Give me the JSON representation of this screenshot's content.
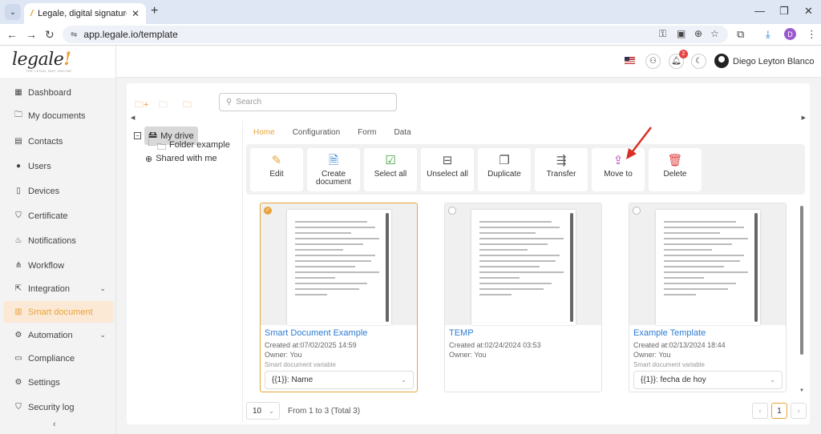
{
  "browser": {
    "tab_title": "Legale, digital signature",
    "url_site_icon": "⇋",
    "url": "app.legale.io/template",
    "profile_initial": "D"
  },
  "header": {
    "logo": "legale",
    "logo_tagline": "THE LEGAL WAY ONLINE",
    "notifications_count": "2",
    "username": "Diego Leyton Blanco"
  },
  "sidebar": {
    "items": [
      {
        "label": "Dashboard",
        "icon": "grid-icon"
      },
      {
        "label": "My documents",
        "icon": "folder-icon"
      },
      {
        "label": "Contacts",
        "icon": "contacts-icon"
      },
      {
        "label": "Users",
        "icon": "user-icon"
      },
      {
        "label": "Devices",
        "icon": "device-icon"
      },
      {
        "label": "Certificate",
        "icon": "shield-icon"
      },
      {
        "label": "Notifications",
        "icon": "bell-icon"
      },
      {
        "label": "Workflow",
        "icon": "workflow-icon"
      },
      {
        "label": "Integration",
        "icon": "integration-icon"
      },
      {
        "label": "Smart document",
        "icon": "smart-doc-icon"
      },
      {
        "label": "Automation",
        "icon": "automation-icon"
      },
      {
        "label": "Compliance",
        "icon": "compliance-icon"
      },
      {
        "label": "Settings",
        "icon": "settings-icon"
      },
      {
        "label": "Security log",
        "icon": "security-icon"
      }
    ],
    "active": "Smart document"
  },
  "search": {
    "placeholder": "Search"
  },
  "tree": {
    "root": "My drive",
    "child": "Folder example",
    "shared": "Shared with me"
  },
  "tabs": [
    "Home",
    "Configuration",
    "Form",
    "Data"
  ],
  "actions": [
    {
      "label": "Edit",
      "icon": "pencil-icon",
      "color": "#e8a33a"
    },
    {
      "label": "Create document",
      "icon": "create-doc-icon",
      "color": "#2d7bd1"
    },
    {
      "label": "Select all",
      "icon": "select-all-icon",
      "color": "#3a9d3a"
    },
    {
      "label": "Unselect all",
      "icon": "unselect-all-icon",
      "color": "#555555"
    },
    {
      "label": "Duplicate",
      "icon": "duplicate-icon",
      "color": "#555555"
    },
    {
      "label": "Transfer",
      "icon": "transfer-icon",
      "color": "#555555"
    },
    {
      "label": "Move to",
      "icon": "move-to-icon",
      "color": "#c040c0"
    },
    {
      "label": "Delete",
      "icon": "trash-icon",
      "color": "#e04040"
    }
  ],
  "cards": [
    {
      "title": "Smart Document Example",
      "created": "Created at:07/02/2025 14:59",
      "owner": "Owner: You",
      "variable_label": "Smart document variable",
      "variable_value": "{{1}}: Name",
      "selected": true
    },
    {
      "title": "TEMP",
      "created": "Created at:02/24/2024 03:53",
      "owner": "Owner: You",
      "variable_label": "",
      "variable_value": "",
      "selected": false
    },
    {
      "title": "Example Template",
      "created": "Created at:02/13/2024 18:44",
      "owner": "Owner: You",
      "variable_label": "Smart document variable",
      "variable_value": "{{1}}: fecha de hoy",
      "selected": false
    }
  ],
  "pagination": {
    "page_size": "10",
    "info": "From 1 to 3 (Total 3)",
    "current_page": "1"
  },
  "colors": {
    "accent": "#e8a33a",
    "link": "#2d7bd1",
    "annotation_arrow": "#d93025"
  }
}
